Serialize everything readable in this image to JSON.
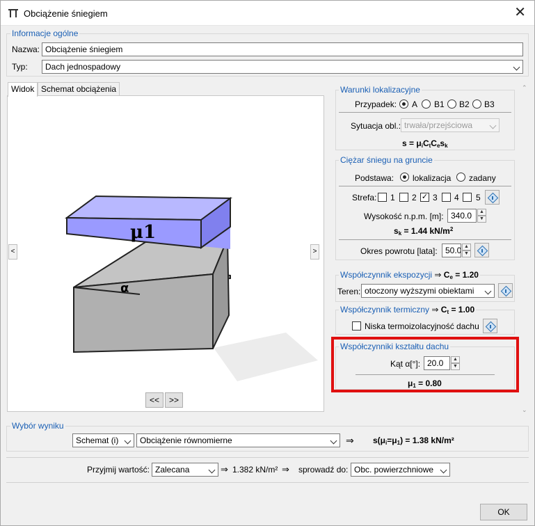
{
  "window": {
    "title": "Obciążenie śniegiem"
  },
  "general": {
    "group_title": "Informacje ogólne",
    "name_label": "Nazwa:",
    "name_value": "Obciążenie śniegiem",
    "type_label": "Typ:",
    "type_value": "Dach jednospadowy"
  },
  "tabs": {
    "view": "Widok",
    "load_scheme": "Schemat obciążenia"
  },
  "view": {
    "nav_prev": "<",
    "nav_next": ">",
    "mu_label": "μ1",
    "alpha_label": "α",
    "btn_back": "<<",
    "btn_fwd": ">>"
  },
  "location": {
    "group_title": "Warunki lokalizacyjne",
    "case_label": "Przypadek:",
    "case_options": [
      "A",
      "B1",
      "B2",
      "B3"
    ],
    "case_selected": "A",
    "situation_label": "Sytuacja obl.:",
    "situation_value": "trwała/przejściowa",
    "formula": "s = μ",
    "formula_sub_i": "i",
    "formula_C": "C",
    "formula_sub_t": "t",
    "formula_sub_e": "e",
    "formula_s": "s",
    "formula_sub_k": "k"
  },
  "ground_snow": {
    "group_title": "Ciężar śniegu na gruncie",
    "basis_label": "Podstawa:",
    "basis_opt1": "lokalizacja",
    "basis_opt2": "zadany",
    "zone_label": "Strefa:",
    "zones": [
      "1",
      "2",
      "3",
      "4",
      "5"
    ],
    "zone_checked": "3",
    "altitude_label": "Wysokość n.p.m. [m]:",
    "altitude_value": "340.0",
    "sk_prefix": "s",
    "sk_sub": "k",
    "sk_value": " = 1.44 kN/m",
    "sk_sup": "2",
    "return_label": "Okres powrotu [lata]:",
    "return_value": "50.0"
  },
  "exposure": {
    "group_title": "Współczynnik ekspozycji",
    "arrow": "⇒",
    "ce_prefix": "C",
    "ce_sub": "e",
    "ce_value": " = 1.20",
    "terrain_label": "Teren:",
    "terrain_value": "otoczony wyższymi obiektami"
  },
  "thermal": {
    "group_title": "Współczynnik termiczny",
    "arrow": "⇒",
    "ct_prefix": "C",
    "ct_sub": "t",
    "ct_value": " = 1.00",
    "low_insulation_label": "Niska termoizolacyjność dachu"
  },
  "shape": {
    "group_title": "Współczynniki kształtu dachu",
    "angle_label": "Kąt α[°]:",
    "angle_value": "20.0",
    "mu_prefix": "μ",
    "mu_sub": "1",
    "mu_value": " = 0.80"
  },
  "result": {
    "group_title": "Wybór wyniku",
    "scheme_value": "Schemat (i)",
    "load_value": "Obciążenie równomierne",
    "arrow": "⇒",
    "res_prefix": "s(μ",
    "res_sub_i": "i",
    "res_mid": "=μ",
    "res_sub_1": "1",
    "res_value": ") = 1.38 kN/m²"
  },
  "accept": {
    "label": "Przyjmij wartość:",
    "value": "Zalecana",
    "arrow1": "⇒",
    "result": "1.382 kN/m²",
    "arrow2": "⇒",
    "check_label": "sprowadź do:",
    "check_value": "Obc. powierzchniowe"
  },
  "footer": {
    "ok_label": "OK"
  },
  "colors": {
    "accent": "#1a5fb4",
    "highlight": "#e01010",
    "mu_box": "#9a9aff",
    "block": "#bfbfbf"
  }
}
